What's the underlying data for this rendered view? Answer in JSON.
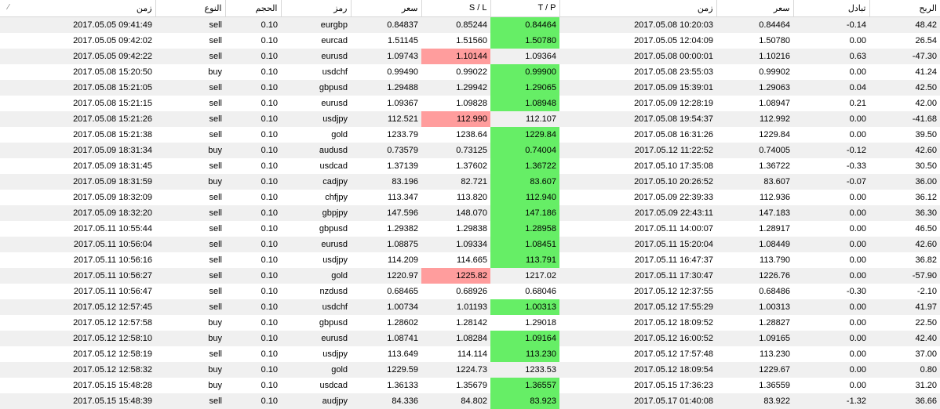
{
  "headers": {
    "open_time": "زمن",
    "type": "النوع",
    "size": "الحجم",
    "symbol": "رمز",
    "open_price": "سعر",
    "sl": "S / L",
    "tp": "T / P",
    "close_time": "زمن",
    "close_price": "سعر",
    "swap": "تبادل",
    "profit": "الربح"
  },
  "colors": {
    "sl_hit": "#ff9d9d",
    "tp_hit": "#66ee66",
    "row_alt": "#f0f0f0"
  },
  "rows": [
    {
      "open_time": "2017.05.05 09:41:49",
      "type": "sell",
      "size": "0.10",
      "symbol": "eurgbp",
      "open_price": "0.84837",
      "sl": "0.85244",
      "tp": "0.84464",
      "close_time": "2017.05.08 10:20:03",
      "close_price": "0.84464",
      "swap": "-0.14",
      "profit": "48.42",
      "hit": "tp"
    },
    {
      "open_time": "2017.05.05 09:42:02",
      "type": "sell",
      "size": "0.10",
      "symbol": "eurcad",
      "open_price": "1.51145",
      "sl": "1.51560",
      "tp": "1.50780",
      "close_time": "2017.05.05 12:04:09",
      "close_price": "1.50780",
      "swap": "0.00",
      "profit": "26.54",
      "hit": "tp"
    },
    {
      "open_time": "2017.05.05 09:42:22",
      "type": "sell",
      "size": "0.10",
      "symbol": "eurusd",
      "open_price": "1.09743",
      "sl": "1.10144",
      "tp": "1.09364",
      "close_time": "2017.05.08 00:00:01",
      "close_price": "1.10216",
      "swap": "0.63",
      "profit": "-47.30",
      "hit": "sl"
    },
    {
      "open_time": "2017.05.08 15:20:50",
      "type": "buy",
      "size": "0.10",
      "symbol": "usdchf",
      "open_price": "0.99490",
      "sl": "0.99022",
      "tp": "0.99900",
      "close_time": "2017.05.08 23:55:03",
      "close_price": "0.99902",
      "swap": "0.00",
      "profit": "41.24",
      "hit": "tp"
    },
    {
      "open_time": "2017.05.08 15:21:05",
      "type": "sell",
      "size": "0.10",
      "symbol": "gbpusd",
      "open_price": "1.29488",
      "sl": "1.29942",
      "tp": "1.29065",
      "close_time": "2017.05.09 15:39:01",
      "close_price": "1.29063",
      "swap": "0.04",
      "profit": "42.50",
      "hit": "tp"
    },
    {
      "open_time": "2017.05.08 15:21:15",
      "type": "sell",
      "size": "0.10",
      "symbol": "eurusd",
      "open_price": "1.09367",
      "sl": "1.09828",
      "tp": "1.08948",
      "close_time": "2017.05.09 12:28:19",
      "close_price": "1.08947",
      "swap": "0.21",
      "profit": "42.00",
      "hit": "tp"
    },
    {
      "open_time": "2017.05.08 15:21:26",
      "type": "sell",
      "size": "0.10",
      "symbol": "usdjpy",
      "open_price": "112.521",
      "sl": "112.990",
      "tp": "112.107",
      "close_time": "2017.05.08 19:54:37",
      "close_price": "112.992",
      "swap": "0.00",
      "profit": "-41.68",
      "hit": "sl"
    },
    {
      "open_time": "2017.05.08 15:21:38",
      "type": "sell",
      "size": "0.10",
      "symbol": "gold",
      "open_price": "1233.79",
      "sl": "1238.64",
      "tp": "1229.84",
      "close_time": "2017.05.08 16:31:26",
      "close_price": "1229.84",
      "swap": "0.00",
      "profit": "39.50",
      "hit": "tp"
    },
    {
      "open_time": "2017.05.09 18:31:34",
      "type": "buy",
      "size": "0.10",
      "symbol": "audusd",
      "open_price": "0.73579",
      "sl": "0.73125",
      "tp": "0.74004",
      "close_time": "2017.05.12 11:22:52",
      "close_price": "0.74005",
      "swap": "-0.12",
      "profit": "42.60",
      "hit": "tp"
    },
    {
      "open_time": "2017.05.09 18:31:45",
      "type": "sell",
      "size": "0.10",
      "symbol": "usdcad",
      "open_price": "1.37139",
      "sl": "1.37602",
      "tp": "1.36722",
      "close_time": "2017.05.10 17:35:08",
      "close_price": "1.36722",
      "swap": "-0.33",
      "profit": "30.50",
      "hit": "tp"
    },
    {
      "open_time": "2017.05.09 18:31:59",
      "type": "buy",
      "size": "0.10",
      "symbol": "cadjpy",
      "open_price": "83.196",
      "sl": "82.721",
      "tp": "83.607",
      "close_time": "2017.05.10 20:26:52",
      "close_price": "83.607",
      "swap": "-0.07",
      "profit": "36.00",
      "hit": "tp"
    },
    {
      "open_time": "2017.05.09 18:32:09",
      "type": "sell",
      "size": "0.10",
      "symbol": "chfjpy",
      "open_price": "113.347",
      "sl": "113.820",
      "tp": "112.940",
      "close_time": "2017.05.09 22:39:33",
      "close_price": "112.936",
      "swap": "0.00",
      "profit": "36.12",
      "hit": "tp"
    },
    {
      "open_time": "2017.05.09 18:32:20",
      "type": "sell",
      "size": "0.10",
      "symbol": "gbpjpy",
      "open_price": "147.596",
      "sl": "148.070",
      "tp": "147.186",
      "close_time": "2017.05.09 22:43:11",
      "close_price": "147.183",
      "swap": "0.00",
      "profit": "36.30",
      "hit": "tp"
    },
    {
      "open_time": "2017.05.11 10:55:44",
      "type": "sell",
      "size": "0.10",
      "symbol": "gbpusd",
      "open_price": "1.29382",
      "sl": "1.29838",
      "tp": "1.28958",
      "close_time": "2017.05.11 14:00:07",
      "close_price": "1.28917",
      "swap": "0.00",
      "profit": "46.50",
      "hit": "tp"
    },
    {
      "open_time": "2017.05.11 10:56:04",
      "type": "sell",
      "size": "0.10",
      "symbol": "eurusd",
      "open_price": "1.08875",
      "sl": "1.09334",
      "tp": "1.08451",
      "close_time": "2017.05.11 15:20:04",
      "close_price": "1.08449",
      "swap": "0.00",
      "profit": "42.60",
      "hit": "tp"
    },
    {
      "open_time": "2017.05.11 10:56:16",
      "type": "sell",
      "size": "0.10",
      "symbol": "usdjpy",
      "open_price": "114.209",
      "sl": "114.665",
      "tp": "113.791",
      "close_time": "2017.05.11 16:47:37",
      "close_price": "113.790",
      "swap": "0.00",
      "profit": "36.82",
      "hit": "tp"
    },
    {
      "open_time": "2017.05.11 10:56:27",
      "type": "sell",
      "size": "0.10",
      "symbol": "gold",
      "open_price": "1220.97",
      "sl": "1225.82",
      "tp": "1217.02",
      "close_time": "2017.05.11 17:30:47",
      "close_price": "1226.76",
      "swap": "0.00",
      "profit": "-57.90",
      "hit": "sl"
    },
    {
      "open_time": "2017.05.11 10:56:47",
      "type": "sell",
      "size": "0.10",
      "symbol": "nzdusd",
      "open_price": "0.68465",
      "sl": "0.68926",
      "tp": "0.68046",
      "close_time": "2017.05.12 12:37:55",
      "close_price": "0.68486",
      "swap": "-0.30",
      "profit": "-2.10",
      "hit": ""
    },
    {
      "open_time": "2017.05.12 12:57:45",
      "type": "sell",
      "size": "0.10",
      "symbol": "usdchf",
      "open_price": "1.00734",
      "sl": "1.01193",
      "tp": "1.00313",
      "close_time": "2017.05.12 17:55:29",
      "close_price": "1.00313",
      "swap": "0.00",
      "profit": "41.97",
      "hit": "tp"
    },
    {
      "open_time": "2017.05.12 12:57:58",
      "type": "buy",
      "size": "0.10",
      "symbol": "gbpusd",
      "open_price": "1.28602",
      "sl": "1.28142",
      "tp": "1.29018",
      "close_time": "2017.05.12 18:09:52",
      "close_price": "1.28827",
      "swap": "0.00",
      "profit": "22.50",
      "hit": ""
    },
    {
      "open_time": "2017.05.12 12:58:10",
      "type": "buy",
      "size": "0.10",
      "symbol": "eurusd",
      "open_price": "1.08741",
      "sl": "1.08284",
      "tp": "1.09164",
      "close_time": "2017.05.12 16:00:52",
      "close_price": "1.09165",
      "swap": "0.00",
      "profit": "42.40",
      "hit": "tp"
    },
    {
      "open_time": "2017.05.12 12:58:19",
      "type": "sell",
      "size": "0.10",
      "symbol": "usdjpy",
      "open_price": "113.649",
      "sl": "114.114",
      "tp": "113.230",
      "close_time": "2017.05.12 17:57:48",
      "close_price": "113.230",
      "swap": "0.00",
      "profit": "37.00",
      "hit": "tp"
    },
    {
      "open_time": "2017.05.12 12:58:32",
      "type": "buy",
      "size": "0.10",
      "symbol": "gold",
      "open_price": "1229.59",
      "sl": "1224.73",
      "tp": "1233.53",
      "close_time": "2017.05.12 18:09:54",
      "close_price": "1229.67",
      "swap": "0.00",
      "profit": "0.80",
      "hit": ""
    },
    {
      "open_time": "2017.05.15 15:48:28",
      "type": "buy",
      "size": "0.10",
      "symbol": "usdcad",
      "open_price": "1.36133",
      "sl": "1.35679",
      "tp": "1.36557",
      "close_time": "2017.05.15 17:36:23",
      "close_price": "1.36559",
      "swap": "0.00",
      "profit": "31.20",
      "hit": "tp"
    },
    {
      "open_time": "2017.05.15 15:48:39",
      "type": "sell",
      "size": "0.10",
      "symbol": "audjpy",
      "open_price": "84.336",
      "sl": "84.802",
      "tp": "83.923",
      "close_time": "2017.05.17 01:40:08",
      "close_price": "83.922",
      "swap": "-1.32",
      "profit": "36.66",
      "hit": "tp"
    }
  ]
}
